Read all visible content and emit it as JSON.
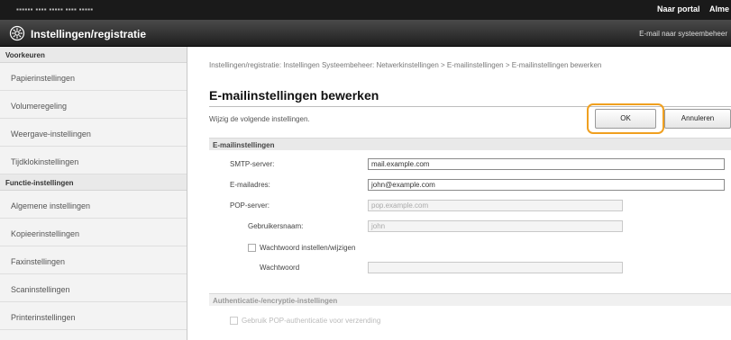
{
  "topbar": {
    "device": "▪▪▪▪▪▪   ▪▪▪▪ ▪▪▪▪▪ ▪▪▪▪ ▪▪▪▪▪",
    "portal_link": "Naar portal",
    "general_link": "Alme"
  },
  "titlebar": {
    "title": "Instellingen/registratie",
    "mail_link": "E-mail naar systeembeheer"
  },
  "sidebar": {
    "header1": "Voorkeuren",
    "items1": [
      "Papierinstellingen",
      "Volumeregeling",
      "Weergave-instellingen",
      "Tijdklokinstellingen"
    ],
    "header2": "Functie-instellingen",
    "items2": [
      "Algemene instellingen",
      "Kopieerinstellingen",
      "Faxinstellingen",
      "Scaninstellingen",
      "Printerinstellingen"
    ]
  },
  "main": {
    "breadcrumb": "Instellingen/registratie: Instellingen Systeembeheer: Netwerkinstellingen > E-mailinstellingen > E-mailinstellingen bewerken",
    "title": "E-mailinstellingen bewerken",
    "subtitle": "Wijzig de volgende instellingen.",
    "ok_label": "OK",
    "cancel_label": "Annuleren",
    "section1": "E-mailinstellingen",
    "smtp_label": "SMTP-server:",
    "smtp_value": "mail.example.com",
    "email_label": "E-mailadres:",
    "email_value": "john@example.com",
    "pop_label": "POP-server:",
    "pop_value": "pop.example.com",
    "user_label": "Gebruikersnaam:",
    "user_value": "john",
    "pw_check_label": "Wachtwoord instellen/wijzigen",
    "pw_label": "Wachtwoord",
    "section2": "Authenticatie-/encryptie-instellingen",
    "pop_auth_label": "Gebruik POP-authenticatie voor verzending"
  },
  "colors": {
    "highlight": "#f0a020",
    "titlebar": "#2a2a2a"
  }
}
